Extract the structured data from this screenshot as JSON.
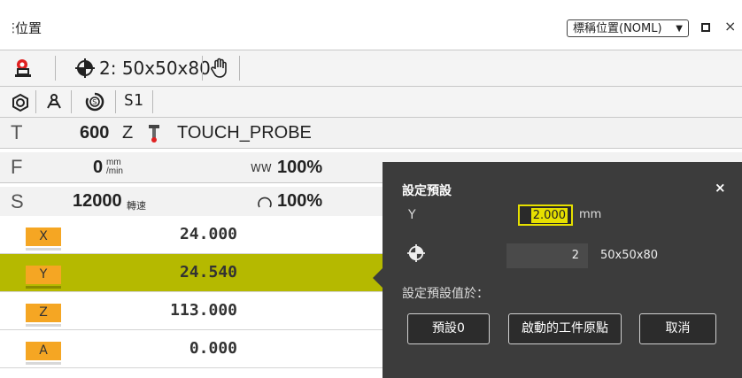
{
  "window": {
    "title": "位置",
    "drag_handle": "⋮",
    "view_dropdown": "標稱位置(NOML)",
    "close": "×"
  },
  "toolbar": {
    "preset_label": "2: 50x50x80",
    "icons": [
      "probe-icon",
      "preset-target-icon",
      "hand-icon"
    ]
  },
  "status_row": {
    "icons": [
      "spindle-icon",
      "kinematics-icon",
      "speed-icon"
    ],
    "s1": "S1"
  },
  "tool_row": {
    "letter": "T",
    "number": "600",
    "axis": "Z",
    "name": "TOUCH_PROBE"
  },
  "feed_row": {
    "letter": "F",
    "value": "0",
    "unit_top": "mm",
    "unit_bottom": "/min",
    "override": "100%"
  },
  "spindle_row": {
    "letter": "S",
    "value": "12000",
    "unit": "轉速",
    "override": "100%"
  },
  "axes": [
    {
      "label": "X",
      "value": "24.000",
      "selected": false
    },
    {
      "label": "Y",
      "value": "24.540",
      "selected": true
    },
    {
      "label": "Z",
      "value": "113.000",
      "selected": false
    },
    {
      "label": "A",
      "value": "0.000",
      "selected": false
    }
  ],
  "popup": {
    "title": "設定預設",
    "close": "×",
    "axis": "Y",
    "input_value": "2.000",
    "unit": "mm",
    "preset_number": "2",
    "preset_name": "50x50x80",
    "set_label": "設定預設值於：",
    "buttons": {
      "preset0": "預設0",
      "active_origin": "啟動的工件原點",
      "cancel": "取消"
    }
  },
  "colors": {
    "selected_row": "#b5b900",
    "axis_badge": "#f5a623",
    "popup_bg": "#3c3c3c",
    "input_highlight": "#e6e000"
  }
}
